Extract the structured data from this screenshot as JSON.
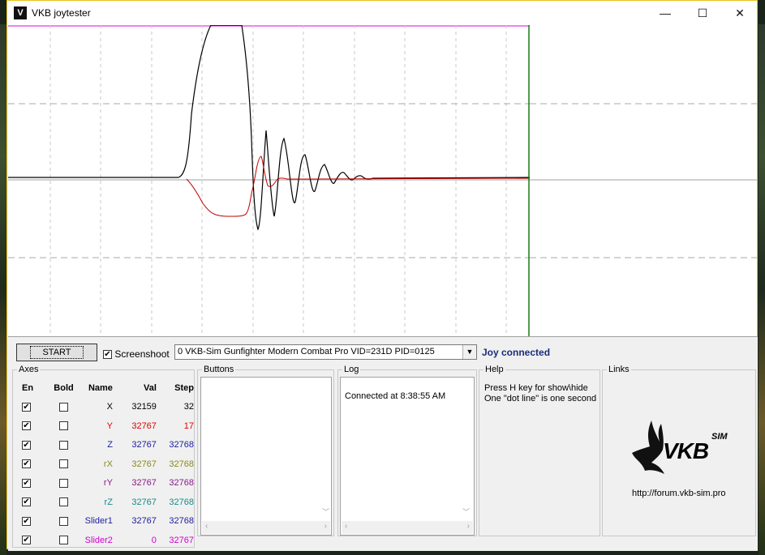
{
  "window": {
    "title": "VKB joytester",
    "minimize": "—",
    "maximize": "☐",
    "close": "✕"
  },
  "toolbar": {
    "start_label": "START",
    "screenshot_label": "Screenshoot",
    "screenshot_checked": true,
    "device_selected": "0  VKB-Sim Gunfighter Modern Combat Pro  VID=231D PID=0125",
    "status": "Joy connected"
  },
  "axes": {
    "title": "Axes",
    "headers": {
      "en": "En",
      "bold": "Bold",
      "name": "Name",
      "val": "Val",
      "step": "Step"
    },
    "rows": [
      {
        "name": "X",
        "val": "32159",
        "step": "32",
        "color": "#000000",
        "en": "✔",
        "bold": ""
      },
      {
        "name": "Y",
        "val": "32767",
        "step": "17",
        "color": "#e00000",
        "en": "✔",
        "bold": ""
      },
      {
        "name": "Z",
        "val": "32767",
        "step": "32768",
        "color": "#1c1ca0",
        "en": "✔",
        "bold": ""
      },
      {
        "name": "rX",
        "val": "32767",
        "step": "32768",
        "color": "#8a8a1a",
        "en": "✔",
        "bold": ""
      },
      {
        "name": "rY",
        "val": "32767",
        "step": "32768",
        "color": "#8a1a8a",
        "en": "✔",
        "bold": ""
      },
      {
        "name": "rZ",
        "val": "32767",
        "step": "32768",
        "color": "#1a8a8a",
        "en": "✔",
        "bold": ""
      },
      {
        "name": "Slider1",
        "val": "32767",
        "step": "32768",
        "color": "#1c1ca0",
        "en": "✔",
        "bold": ""
      },
      {
        "name": "Slider2",
        "val": "0",
        "step": "32767",
        "color": "#d000d0",
        "en": "✔",
        "bold": ""
      }
    ]
  },
  "buttons_group": {
    "title": "Buttons"
  },
  "log": {
    "title": "Log",
    "lines": [
      "Connected at 8:38:55 AM"
    ]
  },
  "help": {
    "title": "Help",
    "line1": "Press H key for show\\hide",
    "line2": "One \"dot line\" is one second"
  },
  "links": {
    "title": "Links",
    "logo_text": "VKB",
    "logo_sup": "SIM",
    "url": "http://forum.vkb-sim.pro"
  },
  "colors": {
    "x_trace": "#000000",
    "y_trace": "#c00000",
    "top_limit": "#e000e0",
    "cursor": "#1a7a1a",
    "status_text": "#1a2d7a"
  }
}
